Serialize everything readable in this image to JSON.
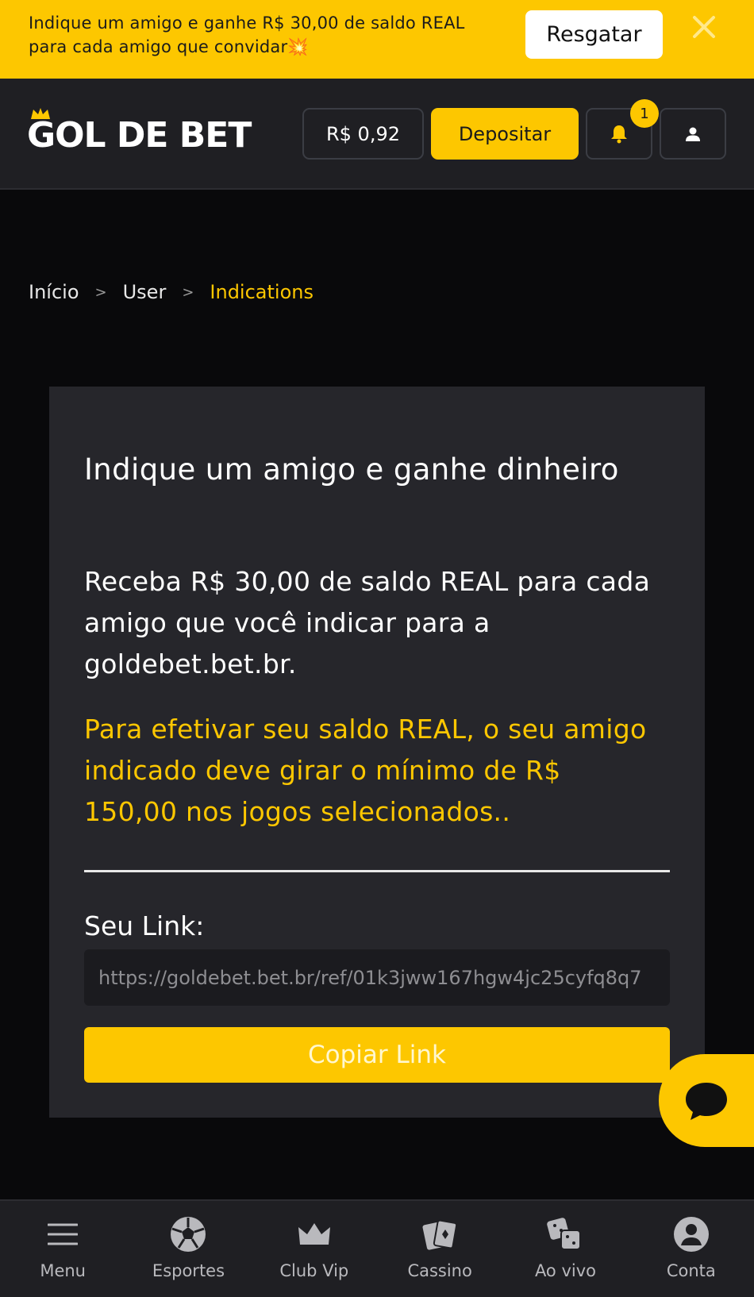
{
  "promo": {
    "text_line1": "Indique um amigo e ganhe R$ 30,00 de saldo REAL",
    "text_line2": "para cada amigo que convidar💥",
    "button": "Resgatar"
  },
  "header": {
    "logo": "GOL DE BET",
    "balance": "R$ 0,92",
    "deposit_label": "Depositar",
    "notification_count": "1"
  },
  "breadcrumb": {
    "items": [
      "Início",
      "User",
      "Indications"
    ],
    "separator": ">"
  },
  "card": {
    "title": "Indique um amigo e ganhe dinheiro",
    "description": "Receba R$ 30,00 de saldo REAL para cada amigo que você indicar para a goldebet.bet.br.",
    "note": "Para efetivar seu saldo REAL, o seu amigo indicado deve girar o mínimo de R$ 150,00 nos jogos selecionados..",
    "link_label": "Seu Link:",
    "link_value": "https://goldebet.bet.br/ref/01k3jww167hgw4jc25cyfq8q7",
    "copy_button": "Copiar Link"
  },
  "bottom_nav": {
    "items": [
      {
        "label": "Menu",
        "icon": "menu-icon"
      },
      {
        "label": "Esportes",
        "icon": "soccer-ball-icon"
      },
      {
        "label": "Club Vip",
        "icon": "crown-icon"
      },
      {
        "label": "Cassino",
        "icon": "cards-icon"
      },
      {
        "label": "Ao vivo",
        "icon": "dice-icon"
      },
      {
        "label": "Conta",
        "icon": "account-icon"
      }
    ]
  },
  "colors": {
    "accent": "#fdc700",
    "background": "#09090b",
    "header": "#1f1f23",
    "card": "#26262b"
  }
}
